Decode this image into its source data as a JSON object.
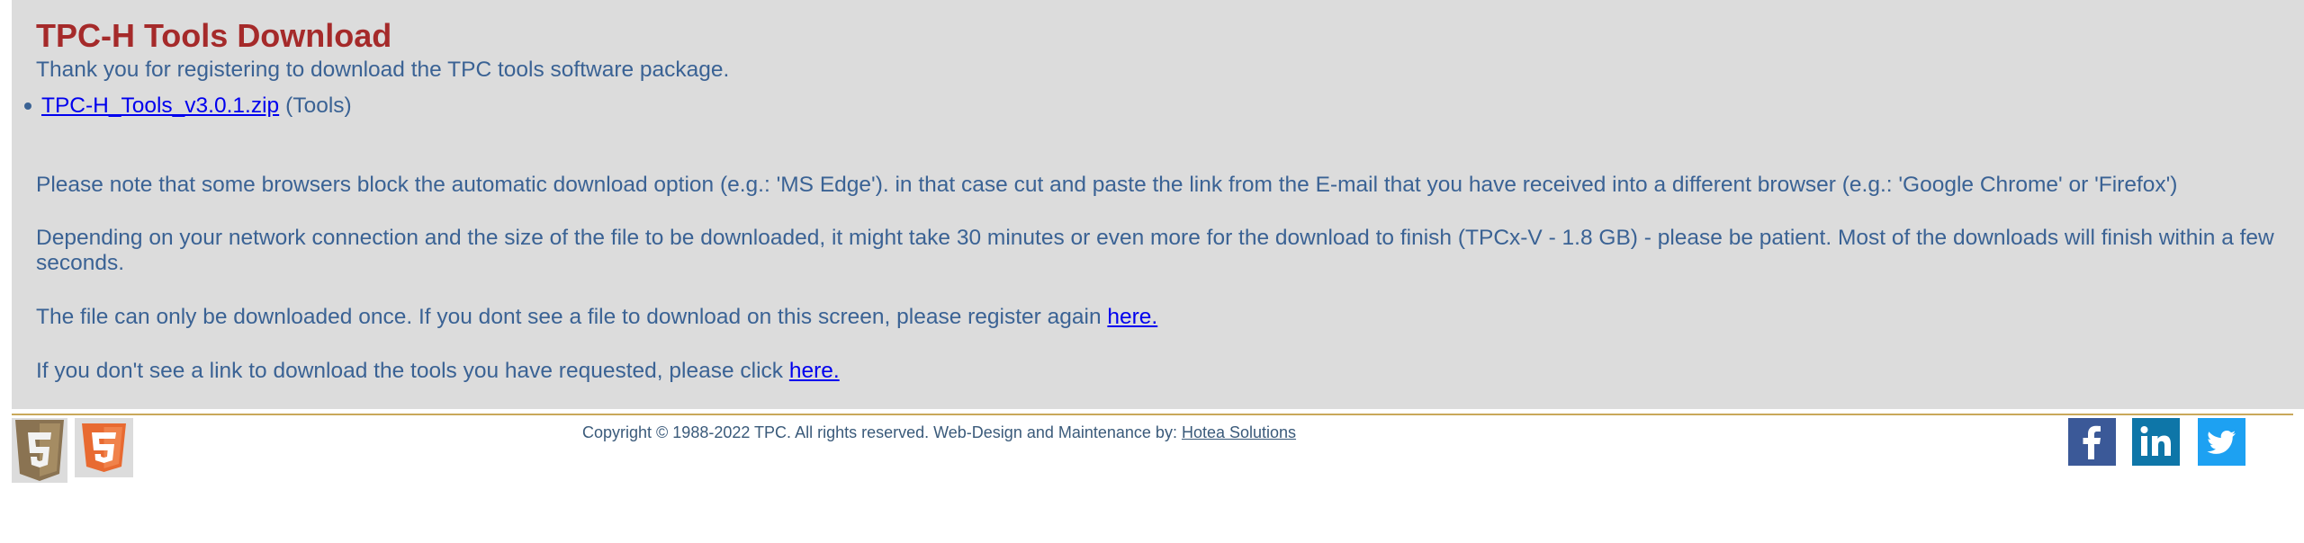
{
  "page": {
    "title": "TPC-H Tools Download",
    "intro": "Thank you for registering to download the TPC tools software package."
  },
  "downloads": [
    {
      "filename": "TPC-H_Tools_v3.0.1.zip",
      "tag": "(Tools)"
    }
  ],
  "notes": {
    "browser_note": "Please note that some browsers block the automatic download option (e.g.: 'MS Edge'). in that case cut and paste the link from the E-mail that you have received into a different browser (e.g.: 'Google Chrome' or 'Firefox')",
    "time_note": "Depending on your network connection and the size of the file to be downloaded, it might take 30 minutes or even more for the download to finish (TPCx-V - 1.8 GB) - please be patient. Most of the downloads will finish within a few seconds.",
    "once_note": "The file can only be downloaded once. If you dont see a file to download on this screen, please register again ",
    "once_link": "here.",
    "nolink_note": "If you don't see a link to download the tools you have requested, please click ",
    "nolink_link": "here."
  },
  "footer": {
    "copyright": "Copyright © 1988-2022 TPC. All rights reserved. Web-Design and Maintenance by: ",
    "designer_link": "Hotea Solutions"
  },
  "colors": {
    "title": "#a52a2a",
    "body_text": "#3a6294",
    "link": "#0000ee",
    "content_bg": "#dcdcdc",
    "footer_rule": "#c9a85a",
    "facebook": "#3b5998",
    "linkedin": "#0e76a8",
    "twitter": "#1da1f2"
  },
  "icons": [
    "html5-icon",
    "css3-icon",
    "facebook-icon",
    "linkedin-icon",
    "twitter-icon"
  ]
}
